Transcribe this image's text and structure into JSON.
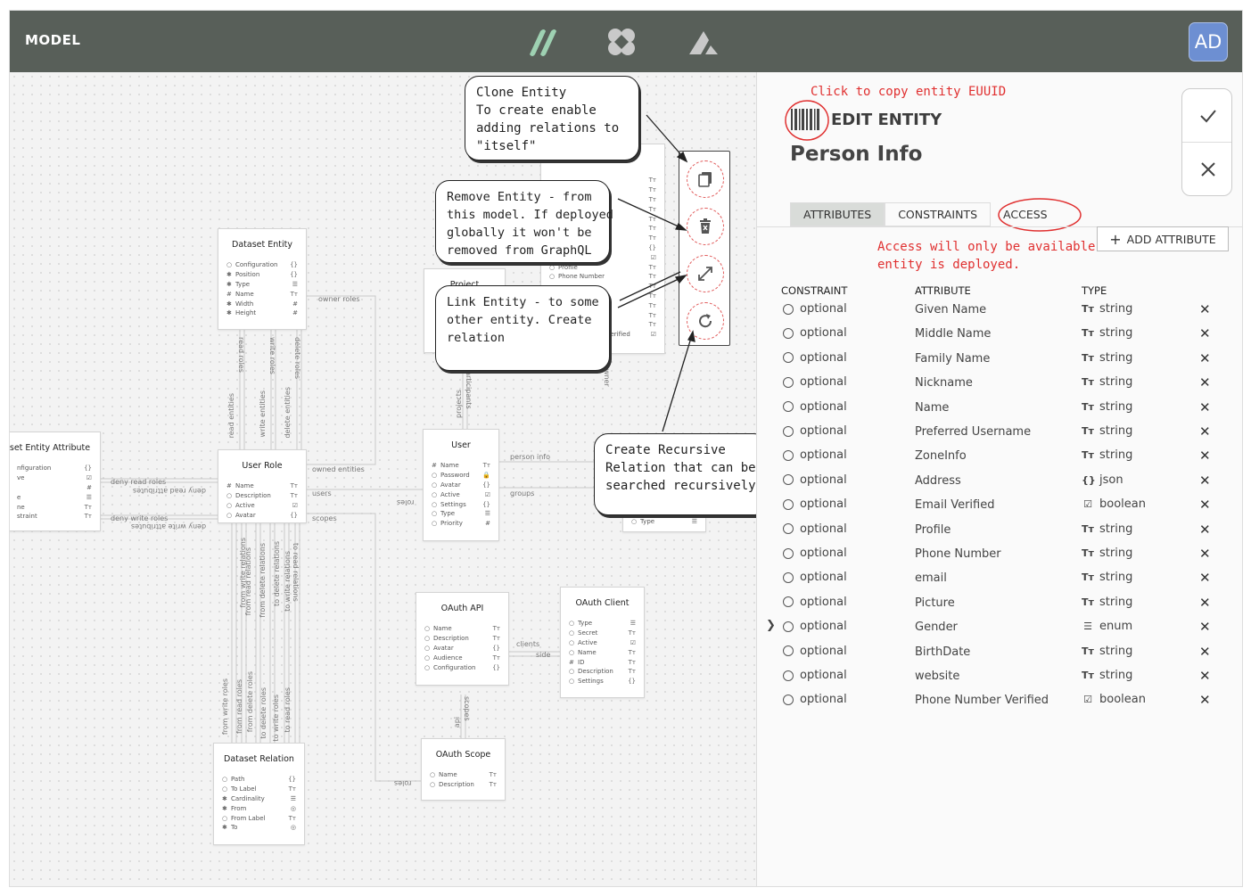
{
  "topbar": {
    "brand": "MODEL",
    "avatar": "AD",
    "logos": [
      "slashes-logo",
      "clover-logo",
      "triangle-logo"
    ]
  },
  "canvas": {
    "entities": {
      "dataset_entity": {
        "title": "Dataset Entity",
        "rows": [
          {
            "g": "○",
            "n": "Configuration",
            "t": "{}"
          },
          {
            "g": "✱",
            "n": "Position",
            "t": "{}"
          },
          {
            "g": "✱",
            "n": "Type",
            "t": "☰"
          },
          {
            "g": "#",
            "n": "Name",
            "t": "Tт"
          },
          {
            "g": "✱",
            "n": "Width",
            "t": "#"
          },
          {
            "g": "✱",
            "n": "Height",
            "t": "#"
          }
        ]
      },
      "dataset_entity_attribute": {
        "title": "set Entity Attribute",
        "rows": [
          {
            "g": "",
            "n": "nfiguration",
            "t": "{}"
          },
          {
            "g": "",
            "n": "ve",
            "t": "☑"
          },
          {
            "g": "",
            "n": "",
            "t": "#"
          },
          {
            "g": "",
            "n": "e",
            "t": "☰"
          },
          {
            "g": "",
            "n": "ne",
            "t": "Tт"
          },
          {
            "g": "",
            "n": "straint",
            "t": "Tт"
          }
        ]
      },
      "user_role": {
        "title": "User Role",
        "rows": [
          {
            "g": "#",
            "n": "Name",
            "t": "Tт"
          },
          {
            "g": "○",
            "n": "Description",
            "t": "Tт"
          },
          {
            "g": "○",
            "n": "Active",
            "t": "☑"
          },
          {
            "g": "○",
            "n": "Avatar",
            "t": "{}"
          }
        ]
      },
      "user": {
        "title": "User",
        "rows": [
          {
            "g": "#",
            "n": "Name",
            "t": "Tт"
          },
          {
            "g": "○",
            "n": "Password",
            "t": "🔒"
          },
          {
            "g": "○",
            "n": "Avatar",
            "t": "{}"
          },
          {
            "g": "○",
            "n": "Active",
            "t": "☑"
          },
          {
            "g": "○",
            "n": "Settings",
            "t": "{}"
          },
          {
            "g": "○",
            "n": "Type",
            "t": "☰"
          },
          {
            "g": "○",
            "n": "Priority",
            "t": "#"
          }
        ]
      },
      "person_info": {
        "title": "Person Info",
        "rows": [
          {
            "g": "",
            "n": "",
            "t": "Tт"
          },
          {
            "g": "",
            "n": "",
            "t": "Tт"
          },
          {
            "g": "",
            "n": "",
            "t": "Tт"
          },
          {
            "g": "",
            "n": "",
            "t": "Tт"
          },
          {
            "g": "",
            "n": "",
            "t": "Tт"
          },
          {
            "g": "",
            "n": "name",
            "t": "Tт"
          },
          {
            "g": "",
            "n": "",
            "t": "Tт"
          },
          {
            "g": "",
            "n": "",
            "t": "{}"
          },
          {
            "g": "○",
            "n": "Email Verified",
            "t": "☑"
          },
          {
            "g": "○",
            "n": "Profile",
            "t": "Tт"
          },
          {
            "g": "○",
            "n": "Phone Number",
            "t": "Tт"
          },
          {
            "g": "",
            "n": "",
            "t": "Tт"
          },
          {
            "g": "",
            "n": "",
            "t": "Tт"
          },
          {
            "g": "",
            "n": "",
            "t": "Tт"
          },
          {
            "g": "",
            "n": "",
            "t": "Tт"
          },
          {
            "g": "",
            "n": "",
            "t": "Tт"
          },
          {
            "g": "○",
            "n": "Phone Number Verified",
            "t": "☑"
          }
        ]
      },
      "oauth_api": {
        "title": "OAuth API",
        "rows": [
          {
            "g": "○",
            "n": "Name",
            "t": "Tт"
          },
          {
            "g": "○",
            "n": "Description",
            "t": "Tт"
          },
          {
            "g": "○",
            "n": "Avatar",
            "t": "{}"
          },
          {
            "g": "○",
            "n": "Audience",
            "t": "Tт"
          },
          {
            "g": "○",
            "n": "Configuration",
            "t": "{}"
          }
        ]
      },
      "oauth_client": {
        "title": "OAuth Client",
        "rows": [
          {
            "g": "○",
            "n": "Type",
            "t": "☰"
          },
          {
            "g": "○",
            "n": "Secret",
            "t": "Tт"
          },
          {
            "g": "○",
            "n": "Active",
            "t": "☑"
          },
          {
            "g": "○",
            "n": "Name",
            "t": "Tт"
          },
          {
            "g": "#",
            "n": "ID",
            "t": "Tт"
          },
          {
            "g": "○",
            "n": "Description",
            "t": "Tт"
          },
          {
            "g": "○",
            "n": "Settings",
            "t": "{}"
          }
        ]
      },
      "oauth_scope": {
        "title": "OAuth Scope",
        "rows": [
          {
            "g": "○",
            "n": "Name",
            "t": "Tт"
          },
          {
            "g": "○",
            "n": "Description",
            "t": "Tт"
          }
        ]
      },
      "dataset_relation": {
        "title": "Dataset Relation",
        "rows": [
          {
            "g": "○",
            "n": "Path",
            "t": "{}"
          },
          {
            "g": "○",
            "n": "To Label",
            "t": "Tт"
          },
          {
            "g": "✱",
            "n": "Cardinality",
            "t": "☰"
          },
          {
            "g": "✱",
            "n": "From",
            "t": "◎"
          },
          {
            "g": "○",
            "n": "From Label",
            "t": "Tт"
          },
          {
            "g": "✱",
            "n": "To",
            "t": "◎"
          }
        ]
      },
      "partial_a": {
        "title": "Project",
        "rows": []
      },
      "partial_b": {
        "title": "",
        "rows": [
          {
            "g": "○",
            "n": "Type",
            "t": "☰"
          }
        ]
      }
    },
    "relation_labels": {
      "owner_roles": "owner roles",
      "read_roles": "read roles",
      "write_roles": "write roles",
      "delete_roles": "delete roles",
      "read_entities": "read entities",
      "write_entities": "write entities",
      "delete_entities": "delete entities",
      "owned_entities": "owned entities",
      "deny_read_roles": "deny read roles",
      "deny_read_attributes": "deny read attributes",
      "deny_write_roles": "deny write roles",
      "deny_write_attributes": "deny write attributes",
      "users": "users",
      "scopes": "scopes",
      "roles": "roles",
      "person_info": "person info",
      "groups": "groups",
      "projects": "projects",
      "participants": "participants",
      "owner": "owner",
      "clients": "clients",
      "side": "side",
      "api": "api",
      "scopes2": "scopes",
      "roles2": "roles",
      "from_write_relations": "from write relations",
      "from_read_relations": "from read relations",
      "from_delete_relations": "from delete relations",
      "to_delete_relations": "to delete relations",
      "to_write_relations": "to write relations",
      "to_read_relations": "to read relations",
      "from_write_roles": "from write roles",
      "from_read_roles": "from read roles",
      "from_delete_roles": "from delete roles",
      "to_delete_roles": "to delete roles",
      "to_write_roles": "to write roles",
      "to_read_roles": "to read roles"
    },
    "callouts": {
      "clone": "Clone Entity\nTo create enable\nadding relations to\n\"itself\"",
      "remove": "Remove Entity - from\nthis model. If deployed\nglobally it won't be\nremoved from GraphQL",
      "link": "Link Entity - to some\nother entity. Create\nrelation",
      "recursive": "Create Recursive\nRelation that can be\nsearched recursively"
    },
    "tools": [
      "copy-icon",
      "delete-icon",
      "link-icon",
      "recursive-icon"
    ]
  },
  "panel": {
    "copy_hint": "Click to copy entity EUUID",
    "edit_title": "EDIT ENTITY",
    "entity_name": "Person Info",
    "tabs": [
      {
        "label": "ATTRIBUTES",
        "active": true
      },
      {
        "label": "CONSTRAINTS",
        "active": false
      },
      {
        "label": "ACCESS",
        "active": false
      }
    ],
    "access_hint": "Access will only be available if\nentity is deployed.",
    "add_attribute": "ADD ATTRIBUTE",
    "headers": {
      "constraint": "CONSTRAINT",
      "attribute": "ATTRIBUTE",
      "type": "TYPE"
    },
    "attributes": [
      {
        "constraint": "optional",
        "name": "Given Name",
        "type": "string",
        "icon": "Tт"
      },
      {
        "constraint": "optional",
        "name": "Middle Name",
        "type": "string",
        "icon": "Tт"
      },
      {
        "constraint": "optional",
        "name": "Family Name",
        "type": "string",
        "icon": "Tт"
      },
      {
        "constraint": "optional",
        "name": "Nickname",
        "type": "string",
        "icon": "Tт"
      },
      {
        "constraint": "optional",
        "name": "Name",
        "type": "string",
        "icon": "Tт"
      },
      {
        "constraint": "optional",
        "name": "Preferred Username",
        "type": "string",
        "icon": "Tт"
      },
      {
        "constraint": "optional",
        "name": "ZoneInfo",
        "type": "string",
        "icon": "Tт"
      },
      {
        "constraint": "optional",
        "name": "Address",
        "type": "json",
        "icon": "{}"
      },
      {
        "constraint": "optional",
        "name": "Email Verified",
        "type": "boolean",
        "icon": "☑"
      },
      {
        "constraint": "optional",
        "name": "Profile",
        "type": "string",
        "icon": "Tт"
      },
      {
        "constraint": "optional",
        "name": "Phone Number",
        "type": "string",
        "icon": "Tт"
      },
      {
        "constraint": "optional",
        "name": "email",
        "type": "string",
        "icon": "Tт"
      },
      {
        "constraint": "optional",
        "name": "Picture",
        "type": "string",
        "icon": "Tт"
      },
      {
        "constraint": "optional",
        "name": "Gender",
        "type": "enum",
        "icon": "☰",
        "expandable": true
      },
      {
        "constraint": "optional",
        "name": "BirthDate",
        "type": "string",
        "icon": "Tт"
      },
      {
        "constraint": "optional",
        "name": "website",
        "type": "string",
        "icon": "Tт"
      },
      {
        "constraint": "optional",
        "name": "Phone Number Verified",
        "type": "boolean",
        "icon": "☑"
      }
    ],
    "colors": {
      "accent_red": "#e03030",
      "topbar": "#585f59",
      "avatar": "#6d8fd2"
    }
  }
}
